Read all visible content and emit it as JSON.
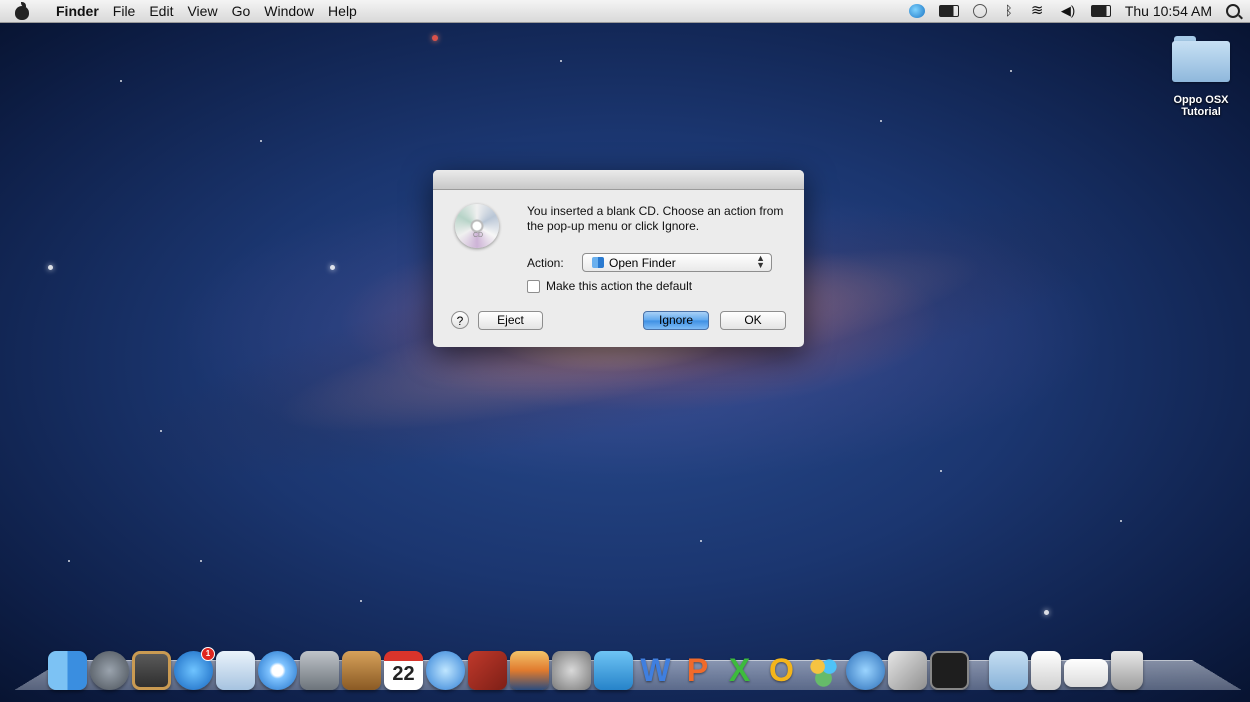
{
  "menubar": {
    "app": "Finder",
    "items": [
      "File",
      "Edit",
      "View",
      "Go",
      "Window",
      "Help"
    ],
    "clock": "Thu 10:54 AM"
  },
  "desktop": {
    "folder_label": "Oppo OSX\nTutorial"
  },
  "dialog": {
    "message": "You inserted a blank CD. Choose an action from the pop-up menu or click Ignore.",
    "cd_icon_text": "CD",
    "action_label": "Action:",
    "action_value": "Open Finder",
    "checkbox_label": "Make this action the default",
    "checkbox_checked": false,
    "help_label": "?",
    "eject_label": "Eject",
    "ignore_label": "Ignore",
    "ok_label": "OK",
    "default_button_color": "#3d8fe3"
  },
  "dock": {
    "calendar_month": "DEC",
    "calendar_day": "22",
    "app_store_badge": "1",
    "word_letter": "W",
    "powerpoint_letter": "P",
    "excel_letter": "X",
    "outlook_letter": "O"
  }
}
